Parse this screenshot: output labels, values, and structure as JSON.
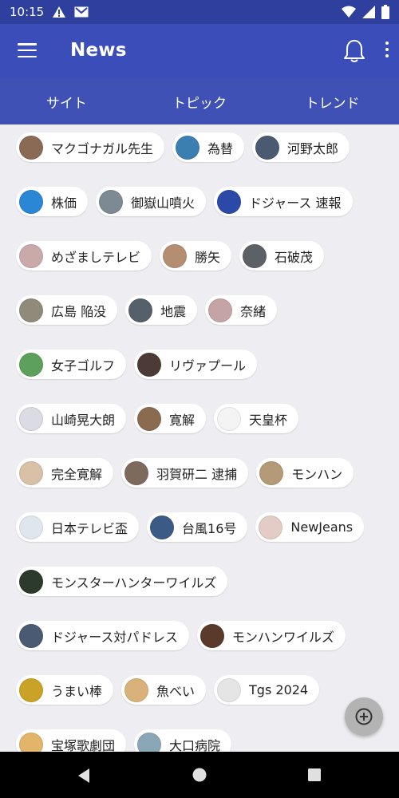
{
  "status": {
    "time": "10:15"
  },
  "app": {
    "title": "News"
  },
  "tabs": [
    {
      "label": "サイト"
    },
    {
      "label": "トピック"
    },
    {
      "label": "トレンド"
    }
  ],
  "chips": [
    {
      "label": "マクゴナガル先生",
      "thumb": "#8a6a55"
    },
    {
      "label": "為替",
      "thumb": "#3a7fb0"
    },
    {
      "label": "河野太郎",
      "thumb": "#4a5a70"
    },
    {
      "label": "株価",
      "thumb": "#2c86d6"
    },
    {
      "label": "御嶽山噴火",
      "thumb": "#7d8a93"
    },
    {
      "label": "ドジャース 速報",
      "thumb": "#2b4aa8"
    },
    {
      "label": "めざましテレビ",
      "thumb": "#c9a9a9"
    },
    {
      "label": "勝矢",
      "thumb": "#b58e72"
    },
    {
      "label": "石破茂",
      "thumb": "#5d6066"
    },
    {
      "label": "広島 陥没",
      "thumb": "#8f8a7a"
    },
    {
      "label": "地震",
      "thumb": "#55606a"
    },
    {
      "label": "奈緒",
      "thumb": "#c4a4a4"
    },
    {
      "label": "女子ゴルフ",
      "thumb": "#5da05b"
    },
    {
      "label": "リヴァプール",
      "thumb": "#4b3a35"
    },
    {
      "label": "山崎晃大朗",
      "thumb": "#dadbe3"
    },
    {
      "label": "寛解",
      "thumb": "#8a6b50"
    },
    {
      "label": "天皇杯",
      "thumb": "#f4f4f4"
    },
    {
      "label": "完全寛解",
      "thumb": "#d9c1a8"
    },
    {
      "label": "羽賀研二 逮捕",
      "thumb": "#7e6a5c"
    },
    {
      "label": "モンハン",
      "thumb": "#b59a78"
    },
    {
      "label": "日本テレビ盃",
      "thumb": "#dfe6ee"
    },
    {
      "label": "台風16号",
      "thumb": "#3b5a86"
    },
    {
      "label": "NewJeans",
      "thumb": "#e2ccc5"
    },
    {
      "label": "モンスターハンターワイルズ",
      "thumb": "#2b3a2a"
    },
    {
      "label": "ドジャース対パドレス",
      "thumb": "#4b5a73"
    },
    {
      "label": "モンハンワイルズ",
      "thumb": "#5a3a2a"
    },
    {
      "label": "うまい棒",
      "thumb": "#c9a227"
    },
    {
      "label": "魚べい",
      "thumb": "#d8b27a"
    },
    {
      "label": "Tgs 2024",
      "thumb": "#e5e5e5"
    },
    {
      "label": "宝塚歌劇団",
      "thumb": "#e3b56a"
    },
    {
      "label": "大口病院",
      "thumb": "#8aa7b8"
    }
  ],
  "colors": {
    "status_bar": "#2f3f9e",
    "app_bar": "#3b4db8",
    "tab_bar": "#3f51b5",
    "background": "#eeeef2",
    "fab": "#b3b3b3"
  },
  "icons": {
    "menu": "hamburger-menu-icon",
    "notifications": "bell-icon",
    "more": "more-vert-icon",
    "fab": "add-circle-icon"
  }
}
